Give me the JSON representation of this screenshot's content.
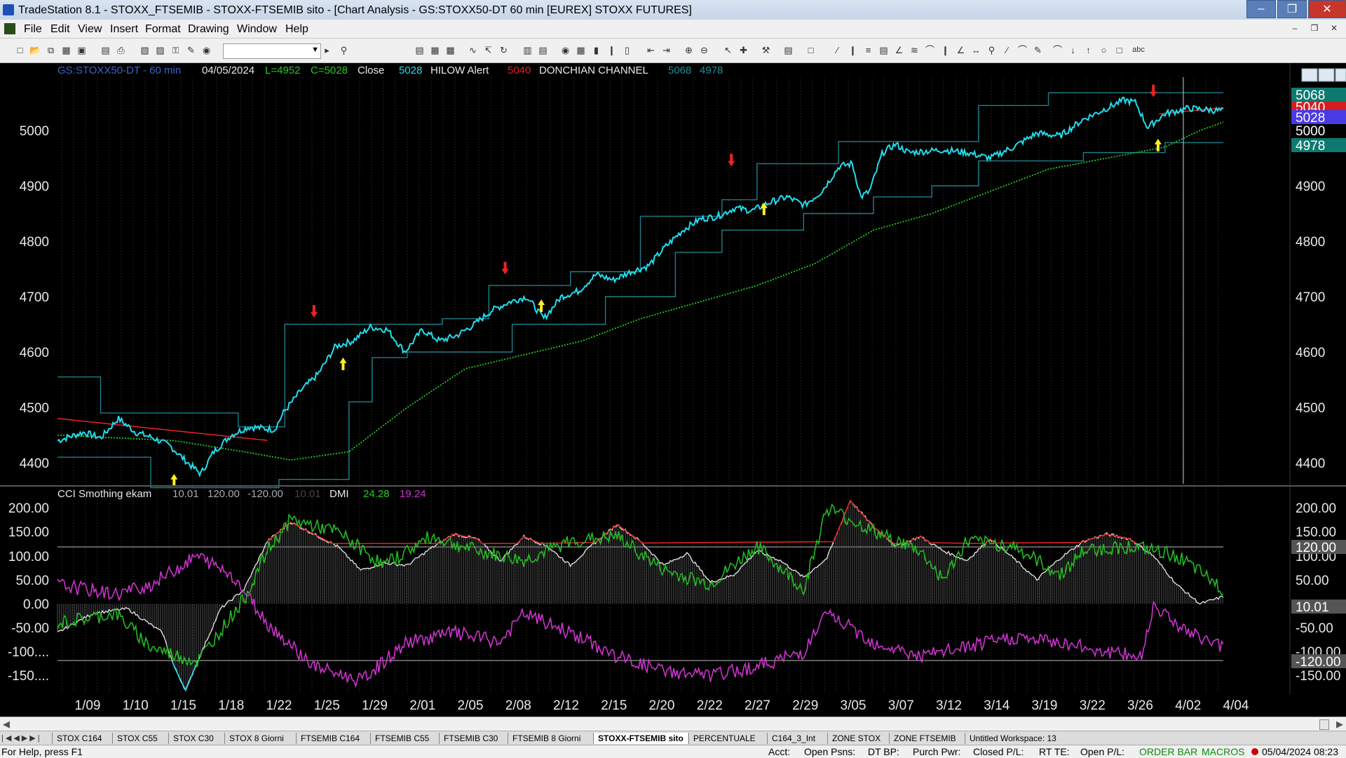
{
  "window": {
    "title": "TradeStation 8.1 - STOXX_FTSEMIB - STOXX-FTSEMIB sito - [Chart Analysis - GS:STOXX50-DT  60 min  [EUREX] STOXX FUTURES]"
  },
  "menu": {
    "items": [
      "File",
      "Edit",
      "View",
      "Insert",
      "Format",
      "Drawing",
      "Window",
      "Help"
    ]
  },
  "chart": {
    "symbol": "GS:STOXX50-DT - 60 min",
    "date": "04/05/2024",
    "low": "L=4952",
    "close_val": "C=5028",
    "close_word": "Close",
    "close_num": "5028",
    "hilow": "HILOW Alert",
    "hilow_val": "5040",
    "donchian": "DONCHIAN CHANNEL",
    "don_up": "5068",
    "don_low": "4978",
    "price_ticks": [
      "5000",
      "4900",
      "4800",
      "4700",
      "4600",
      "4500",
      "4400"
    ],
    "price_badges": [
      "5068",
      "5040",
      "5028",
      "5000",
      "4978"
    ],
    "x_labels": [
      "1/09",
      "1/10",
      "1/15",
      "1/18",
      "1/22",
      "1/25",
      "1/29",
      "2/01",
      "2/05",
      "2/08",
      "2/12",
      "2/15",
      "2/20",
      "2/22",
      "2/27",
      "2/29",
      "3/05",
      "3/07",
      "3/12",
      "3/14",
      "3/19",
      "3/22",
      "3/26",
      "4/02",
      "4/04"
    ],
    "colors": {
      "price": "#22ddee",
      "donchian": "#1f7f8a",
      "hilow": "#dd2222",
      "ma": "#22cc22",
      "cci_green": "#22bb22",
      "magenta": "#cc33cc",
      "arrow_up": "#ffee22",
      "arrow_down": "#ee2222"
    }
  },
  "indicator": {
    "name": "CCI Smothing ekam",
    "v1": "10.01",
    "v2": "120.00",
    "v3": "-120.00",
    "v4": "10.01",
    "dmi": "DMI",
    "dmi1": "24.28",
    "dmi2": "19.24",
    "ticks": [
      "200.00",
      "150.00",
      "100.00",
      "50.00",
      "0.00",
      "-50.00",
      "-100....",
      "-150...."
    ],
    "right_ticks": [
      "200.00",
      "150.00",
      "100.00",
      "50.00",
      "-50.00",
      "-100.00",
      "-150.00"
    ],
    "badges": [
      "120.00",
      "10.01",
      "-120.00"
    ]
  },
  "tabs": [
    "STOX C164",
    "STOX C55",
    "STOX  C30",
    "STOX  8 Giorni",
    "FTSEMIB C164",
    "FTSEMIB C55",
    "FTSEMIB C30",
    "FTSEMIB  8 Giorni",
    "STOXX-FTSEMIB sito",
    "PERCENTUALE",
    "C164_3_Int",
    "ZONE STOX",
    "ZONE FTSEMIB",
    "Untitled Workspace:  13"
  ],
  "active_tab": "STOXX-FTSEMIB sito",
  "status": {
    "help": "For Help, press F1",
    "acct": "Acct:",
    "open_psns": "Open Psns:",
    "dt_bp": "DT BP:",
    "purch_pwr": "Purch Pwr:",
    "closed_pl": "Closed P/L:",
    "rt_te": "RT TE:",
    "open_pl": "Open P/L:",
    "order_bar": "ORDER BAR",
    "macros": "MACROS",
    "datetime": "05/04/2024 08:23"
  }
}
